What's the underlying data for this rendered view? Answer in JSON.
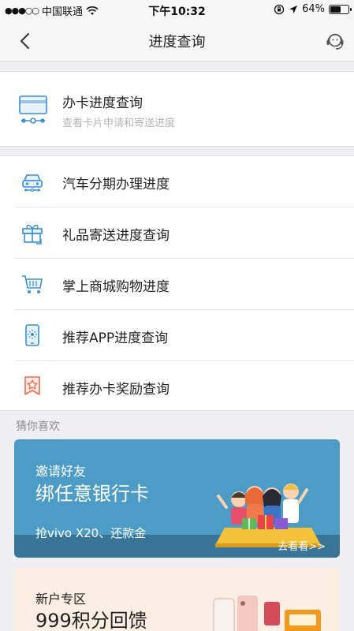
{
  "status_bar": {
    "signal": "●●●○○",
    "carrier": "中国联通",
    "time": "下午10:32",
    "battery_text": "64%",
    "battery_level": 0.64
  },
  "nav": {
    "title": "进度查询",
    "back_icon": "chevron-left-icon",
    "service_icon": "headset-icon"
  },
  "hero": {
    "icon": "card-progress-icon",
    "title": "办卡进度查询",
    "subtitle": "查看卡片申请和寄送进度"
  },
  "list": [
    {
      "icon": "car-icon",
      "label": "汽车分期办理进度"
    },
    {
      "icon": "gift-icon",
      "label": "礼品寄送进度查询"
    },
    {
      "icon": "cart-icon",
      "label": "掌上商城购物进度"
    },
    {
      "icon": "phone-app-icon",
      "label": "推荐APP进度查询"
    },
    {
      "icon": "award-icon",
      "label": "推荐办卡奖励查询"
    }
  ],
  "guess": {
    "label": "猜你喜欢"
  },
  "banner1": {
    "subtitle": "邀请好友",
    "title": "绑任意银行卡",
    "desc": "抢vivo X20、还款金",
    "more": "去看看>>"
  },
  "banner2": {
    "subtitle": "新户专区",
    "title": "999积分回馈"
  },
  "colors": {
    "accent_blue": "#3a8fd6",
    "award_orange": "#ee6a4a",
    "banner1_bg": "#4d9cc8",
    "banner2_bg": "#fbeee2"
  }
}
